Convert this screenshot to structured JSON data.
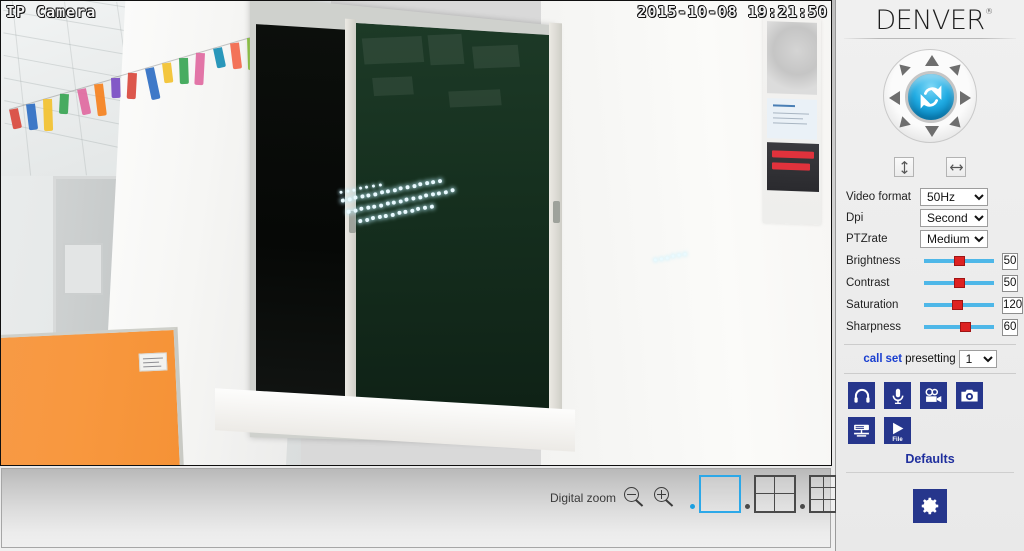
{
  "video": {
    "osd_title": "IP Camera",
    "osd_timestamp": "2015-10-08 19:21:50"
  },
  "toolbar": {
    "digital_zoom_label": "Digital zoom",
    "zoom_out_icon": "magnifier-minus-icon",
    "zoom_in_icon": "magnifier-plus-icon",
    "layouts": [
      {
        "name": "layout-1x1",
        "cells": 1,
        "active": true
      },
      {
        "name": "layout-2x2",
        "cells": 4,
        "active": false
      },
      {
        "name": "layout-3x3",
        "cells": 9,
        "active": false
      }
    ]
  },
  "panel": {
    "brand": "DENVER",
    "brand_mark": "®",
    "ptz": {
      "center_icon": "rotate-refresh-icon",
      "directions": [
        "up",
        "up-right",
        "right",
        "down-right",
        "down",
        "down-left",
        "left",
        "up-left"
      ]
    },
    "flip": {
      "vertical_icon": "flip-vertical-icon",
      "horizontal_icon": "flip-horizontal-icon"
    },
    "settings": [
      {
        "label": "Video format",
        "value": "50Hz"
      },
      {
        "label": "Dpi",
        "value": "Second s"
      },
      {
        "label": "PTZrate",
        "value": "Medium"
      }
    ],
    "sliders": [
      {
        "label": "Brightness",
        "value": "50",
        "percent": 50
      },
      {
        "label": "Contrast",
        "value": "50",
        "percent": 50
      },
      {
        "label": "Saturation",
        "value": "120",
        "percent": 47
      },
      {
        "label": "Sharpness",
        "value": "60",
        "percent": 60
      }
    ],
    "preset": {
      "call_label": "call",
      "set_label": "set",
      "presetting_label": "presetting",
      "value": "1"
    },
    "icons": [
      {
        "name": "headphones-icon",
        "caption": ""
      },
      {
        "name": "microphone-icon",
        "caption": ""
      },
      {
        "name": "video-record-icon",
        "caption": ""
      },
      {
        "name": "snapshot-camera-icon",
        "caption": ""
      },
      {
        "name": "server-icon",
        "caption": ""
      },
      {
        "name": "play-file-icon",
        "caption": "File"
      }
    ],
    "defaults_label": "Defaults",
    "gear_icon": "gear-settings-icon"
  },
  "colors": {
    "brand_blue": "#26368c",
    "accent_cyan": "#2ca8e8",
    "slider_track": "#4eb7e8",
    "slider_thumb": "#dd2222",
    "link_blue": "#1a3fd0"
  }
}
